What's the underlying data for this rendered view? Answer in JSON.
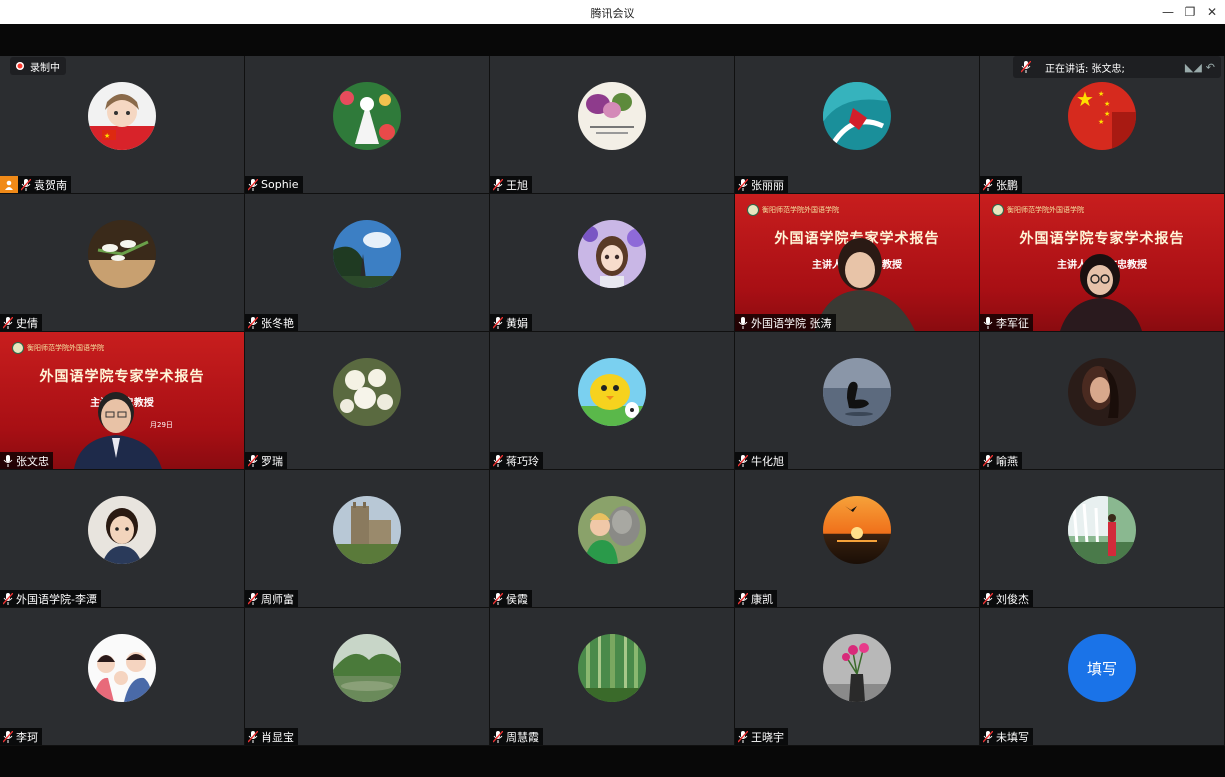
{
  "window": {
    "title": "腾讯会议"
  },
  "recording": {
    "label": "录制中"
  },
  "speaking": {
    "label": "正在讲话: 张文忠;"
  },
  "fill_avatar": {
    "text": "填写",
    "color": "#1a73e8"
  },
  "slide": {
    "school": "衡阳师范学院外国语学院",
    "title": "外国语学院专家学术报告",
    "subtitle_a": "主讲人：张文忠教授",
    "subtitle_b": "主讲  文忠教授",
    "date": "月29日"
  },
  "participants": [
    {
      "name": "袁贺南",
      "avatar": "cartoon-boy",
      "host": true
    },
    {
      "name": "Sophie",
      "avatar": "doll-flowers"
    },
    {
      "name": "王旭",
      "avatar": "flowers-card"
    },
    {
      "name": "张丽丽",
      "avatar": "teal-splash"
    },
    {
      "name": "张鹏",
      "avatar": "china-flag"
    },
    {
      "name": "史倩",
      "avatar": "white-lilies"
    },
    {
      "name": "张冬艳",
      "avatar": "tree-sky"
    },
    {
      "name": "黄娟",
      "avatar": "anime-girl"
    },
    {
      "name": "外国语学院 张涛",
      "video": true,
      "speaking_mic": true
    },
    {
      "name": "李军征",
      "video": true,
      "speaking_mic": true
    },
    {
      "name": "张文忠",
      "video": true,
      "speaking_mic": true
    },
    {
      "name": "罗瑞",
      "avatar": "white-blossoms"
    },
    {
      "name": "蒋巧玲",
      "avatar": "cartoon-chick"
    },
    {
      "name": "牛化旭",
      "avatar": "swan-lake"
    },
    {
      "name": "喻燕",
      "avatar": "woman-portrait"
    },
    {
      "name": "外国语学院-李潭",
      "avatar": "child-photo"
    },
    {
      "name": "周师富",
      "avatar": "castle"
    },
    {
      "name": "侯霞",
      "avatar": "child-donkey"
    },
    {
      "name": "康凯",
      "avatar": "sunset-sea"
    },
    {
      "name": "刘俊杰",
      "avatar": "waterfall-woman"
    },
    {
      "name": "李珂",
      "avatar": "family-cartoon"
    },
    {
      "name": "肖显宝",
      "avatar": "mountain-lake"
    },
    {
      "name": "周慧霞",
      "avatar": "bamboo-forest"
    },
    {
      "name": "王晓宇",
      "avatar": "vase-flowers"
    },
    {
      "name": "未填写",
      "avatar": "fill-text"
    }
  ]
}
